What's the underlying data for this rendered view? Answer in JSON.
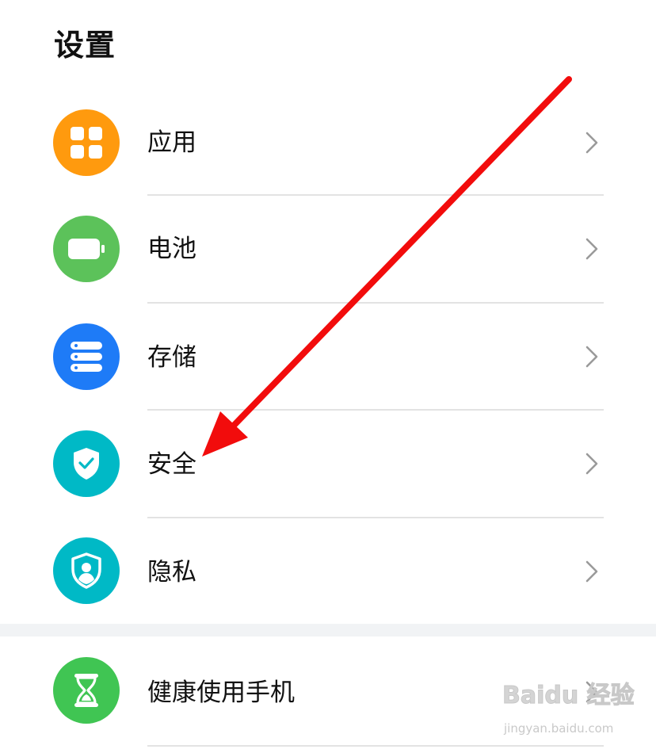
{
  "header": {
    "title": "设置"
  },
  "rows": [
    {
      "label": "应用",
      "icon": "apps-grid-icon",
      "color": "#FF9A0E"
    },
    {
      "label": "电池",
      "icon": "battery-icon",
      "color": "#5CC25A"
    },
    {
      "label": "存储",
      "icon": "storage-icon",
      "color": "#1E7BF7"
    },
    {
      "label": "安全",
      "icon": "shield-check-icon",
      "color": "#00B9C6"
    },
    {
      "label": "隐私",
      "icon": "privacy-shield-icon",
      "color": "#00B9C6"
    },
    {
      "label": "健康使用手机",
      "icon": "hourglass-icon",
      "color": "#40C553"
    }
  ],
  "colors": {
    "arrow": "#F20C0C",
    "divider": "#E3E3E3",
    "section_gap": "#F1F3F5",
    "chevron": "#9A9A9A"
  },
  "watermark": {
    "main": "Baidu 经验",
    "sub": "jingyan.baidu.com"
  }
}
